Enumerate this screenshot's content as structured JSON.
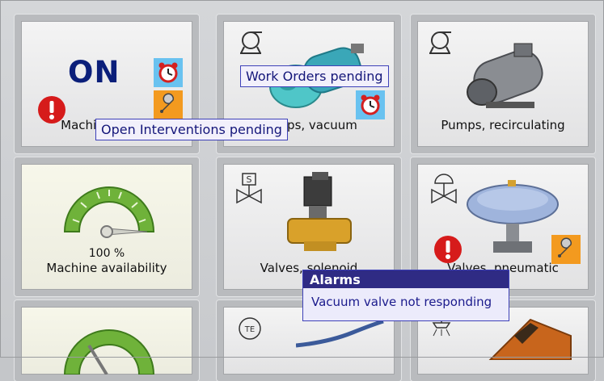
{
  "tiles": {
    "machine": {
      "status": "ON",
      "label": "Machine status"
    },
    "vacuum": {
      "label": "Pumps, vacuum"
    },
    "recirc": {
      "label": "Pumps, recirculating"
    },
    "availability": {
      "value": "100 %",
      "label": "Machine availability",
      "level": 1.0
    },
    "valves": {
      "label": "Valves, solenoid",
      "symbol_text": "S"
    },
    "pneumatic": {
      "label": "Valves, pneumatic"
    },
    "temperature": {
      "symbol_text": "TE"
    }
  },
  "tooltips": {
    "work_orders": "Work Orders pending",
    "interventions": "Open Interventions pending"
  },
  "alarm": {
    "title": "Alarms",
    "message": "Vacuum valve not responding"
  },
  "icons": [
    "alarm-clock-icon",
    "wrench-icon",
    "alert-icon",
    "pump-symbol-icon",
    "valve-symbol-icon",
    "gauge-icon"
  ],
  "colors": {
    "on_text": "#0b1f7a",
    "tooltip_border": "#3e41b9",
    "alarm_header": "#2f2b84",
    "alert_red": "#d61b1b",
    "clock_badge": "#69c2f0",
    "wrench_badge": "#f39a1f",
    "gauge_green": "#5a9e2c"
  }
}
